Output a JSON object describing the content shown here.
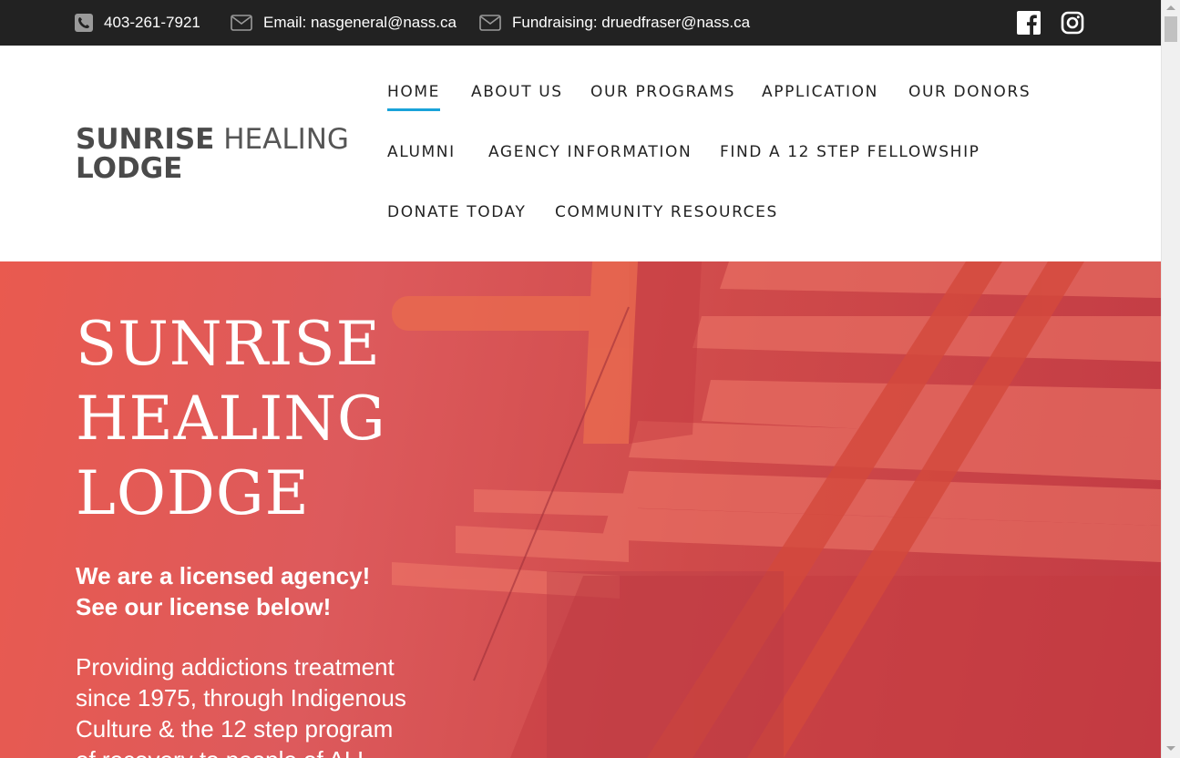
{
  "topbar": {
    "phone": "403-261-7921",
    "email": "Email: nasgeneral@nass.ca",
    "fundraising": "Fundraising: druedfraser@nass.ca",
    "icons": [
      "phone-icon",
      "mail-icon",
      "mail-icon",
      "facebook-icon",
      "instagram-icon"
    ]
  },
  "brand": {
    "bold": "SUNRISE",
    "light": "HEALING",
    "line2": "LODGE"
  },
  "nav": [
    {
      "label": "HOME"
    },
    {
      "label": "ABOUT US"
    },
    {
      "label": "OUR PROGRAMS"
    },
    {
      "label": "APPLICATION"
    },
    {
      "label": "OUR DONORS"
    },
    {
      "label": "ALUMNI"
    },
    {
      "label": "AGENCY INFORMATION"
    },
    {
      "label": "FIND A 12 STEP FELLOWSHIP"
    },
    {
      "label": "DONATE TODAY"
    },
    {
      "label": "COMMUNITY RESOURCES"
    }
  ],
  "hero": {
    "title": [
      "SUNRISE",
      "HEALING",
      "LODGE"
    ],
    "subtitle": [
      "We are a licensed agency!",
      "See our license below!"
    ],
    "body": [
      "Providing addictions treatment",
      "since 1975, through Indigenous",
      "Culture & the 12 step program",
      "of recovery to people of ALL"
    ]
  },
  "colors": {
    "topbar_bg": "#222222",
    "nav_active_underline": "#1aa3d9",
    "hero_overlay": "#e0564f"
  }
}
